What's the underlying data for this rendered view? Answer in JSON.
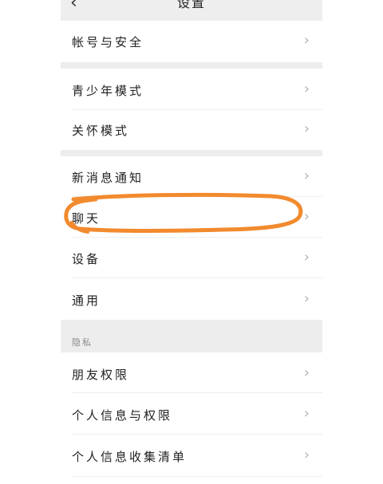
{
  "header": {
    "back_icon": "chevron-left-icon",
    "title": "设置"
  },
  "items": {
    "account": "帐号与安全",
    "youth": "青少年模式",
    "care": "关怀模式",
    "notify": "新消息通知",
    "chat": "聊天",
    "device": "设备",
    "general": "通用",
    "friend_perm": "朋友权限",
    "personal_info": "个人信息与权限",
    "info_list": "个人信息收集清单"
  },
  "sections": {
    "privacy": "隐私"
  },
  "chevron_glyph": "›",
  "colors": {
    "annotation": "#f28a2e",
    "gap": "#ededed"
  }
}
